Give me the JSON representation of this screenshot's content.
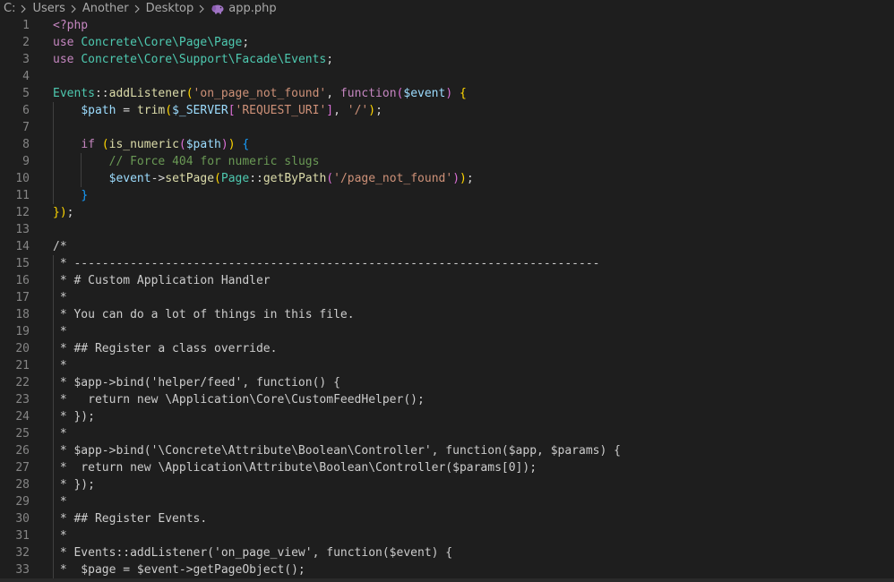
{
  "breadcrumb": {
    "items": [
      "C:",
      "Users",
      "Another",
      "Desktop",
      "app.php"
    ]
  },
  "colors": {
    "background": "#1e1e1e",
    "line_number": "#858585",
    "keyword": "#c586c0",
    "namespace": "#4ec9b0",
    "function": "#dcdcaa",
    "string": "#ce9178",
    "variable": "#9cdcfe",
    "comment": "#6a9955"
  },
  "editor": {
    "lines": [
      {
        "n": "1"
      },
      {
        "n": "2"
      },
      {
        "n": "3"
      },
      {
        "n": "4"
      },
      {
        "n": "5"
      },
      {
        "n": "6"
      },
      {
        "n": "7"
      },
      {
        "n": "8"
      },
      {
        "n": "9"
      },
      {
        "n": "10"
      },
      {
        "n": "11"
      },
      {
        "n": "12"
      },
      {
        "n": "13"
      },
      {
        "n": "14"
      },
      {
        "n": "15"
      },
      {
        "n": "16"
      },
      {
        "n": "17"
      },
      {
        "n": "18"
      },
      {
        "n": "19"
      },
      {
        "n": "20"
      },
      {
        "n": "21"
      },
      {
        "n": "22"
      },
      {
        "n": "23"
      },
      {
        "n": "24"
      },
      {
        "n": "25"
      },
      {
        "n": "26"
      },
      {
        "n": "27"
      },
      {
        "n": "28"
      },
      {
        "n": "29"
      },
      {
        "n": "30"
      },
      {
        "n": "31"
      },
      {
        "n": "32"
      },
      {
        "n": "33"
      }
    ],
    "tokens": {
      "l1": [
        "<?php"
      ],
      "l2": [
        "use",
        " ",
        "Concrete\\Core\\Page\\Page",
        ";"
      ],
      "l3": [
        "use",
        " ",
        "Concrete\\Core\\Support\\Facade\\Events",
        ";"
      ],
      "l5": [
        "Events",
        "::",
        "addListener",
        "(",
        "'on_page_not_found'",
        ", ",
        "function",
        "(",
        "$event",
        ")",
        " ",
        "{"
      ],
      "l6": [
        "    ",
        "$path",
        " = ",
        "trim",
        "(",
        "$_SERVER",
        "[",
        "'REQUEST_URI'",
        "]",
        ", ",
        "'/'",
        ")",
        ";"
      ],
      "l8": [
        "    ",
        "if",
        " ",
        "(",
        "is_numeric",
        "(",
        "$path",
        ")",
        ")",
        " ",
        "{"
      ],
      "l9": [
        "        ",
        "// Force 404 for numeric slugs"
      ],
      "l10": [
        "        ",
        "$event",
        "->",
        "setPage",
        "(",
        "Page",
        "::",
        "getByPath",
        "(",
        "'/page_not_found'",
        ")",
        ")",
        ";"
      ],
      "l11": [
        "    ",
        "}"
      ],
      "l12": [
        "}",
        ")",
        ";"
      ],
      "l14": [
        "/*"
      ],
      "l15": [
        " * ---------------------------------------------------------------------------"
      ],
      "l16": [
        " * # Custom Application Handler"
      ],
      "l17": [
        " *"
      ],
      "l18": [
        " * You can do a lot of things in this file."
      ],
      "l19": [
        " *"
      ],
      "l20": [
        " * ## Register a class override."
      ],
      "l21": [
        " *"
      ],
      "l22": [
        " * $app->bind('helper/feed', function() {"
      ],
      "l23": [
        " *   return new \\Application\\Core\\CustomFeedHelper();"
      ],
      "l24": [
        " * });"
      ],
      "l25": [
        " *"
      ],
      "l26": [
        " * $app->bind('\\Concrete\\Attribute\\Boolean\\Controller', function($app, $params) {"
      ],
      "l27": [
        " *  return new \\Application\\Attribute\\Boolean\\Controller($params[0]);"
      ],
      "l28": [
        " * });"
      ],
      "l29": [
        " *"
      ],
      "l30": [
        " * ## Register Events."
      ],
      "l31": [
        " *"
      ],
      "l32": [
        " * Events::addListener('on_page_view', function($event) {"
      ],
      "l33": [
        " *  $page = $event->getPageObject();"
      ]
    }
  }
}
